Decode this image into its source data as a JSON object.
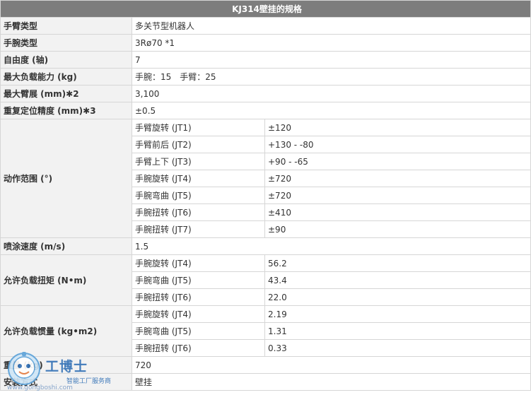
{
  "title": "KJ314壁挂的规格",
  "rows": {
    "arm_type": {
      "label": "手臂类型",
      "value": "多关节型机器人"
    },
    "wrist_type": {
      "label": "手腕类型",
      "value": "3Rø70 *1"
    },
    "dof": {
      "label": "自由度 (轴)",
      "value": "7"
    },
    "payload": {
      "label": "最大负载能力 (kg)",
      "value": "手腕：15　手臂：25"
    },
    "reach": {
      "label": "最大臂展 (mm)✱2",
      "value": "3,100"
    },
    "repeatability": {
      "label": "重复定位精度 (mm)✱3",
      "value": "±0.5"
    },
    "motion_range": {
      "label": "动作范围 (°)",
      "items": [
        {
          "axis": "手臂旋转 (JT1)",
          "value": "±120"
        },
        {
          "axis": "手臂前后 (JT2)",
          "value": "+130 - -80"
        },
        {
          "axis": "手臂上下 (JT3)",
          "value": "+90 - -65"
        },
        {
          "axis": "手腕旋转 (JT4)",
          "value": "±720"
        },
        {
          "axis": "手腕弯曲 (JT5)",
          "value": "±720"
        },
        {
          "axis": "手腕扭转 (JT6)",
          "value": "±410"
        },
        {
          "axis": "手腕扭转 (JT7)",
          "value": "±90"
        }
      ]
    },
    "spray_speed": {
      "label": "喷涂速度 (m/s)",
      "value": "1.5"
    },
    "torque": {
      "label": "允许负载扭矩 (N•m)",
      "items": [
        {
          "axis": "手腕旋转 (JT4)",
          "value": "56.2"
        },
        {
          "axis": "手腕弯曲 (JT5)",
          "value": "43.4"
        },
        {
          "axis": "手腕扭转 (JT6)",
          "value": "22.0"
        }
      ]
    },
    "inertia": {
      "label": "允许负载惯量 (kg•m2)",
      "items": [
        {
          "axis": "手腕旋转 (JT4)",
          "value": "2.19"
        },
        {
          "axis": "手腕弯曲 (JT5)",
          "value": "1.31"
        },
        {
          "axis": "手腕扭转 (JT6)",
          "value": "0.33"
        }
      ]
    },
    "weight": {
      "label": "重量 (kg)",
      "value": "720"
    },
    "mounting": {
      "label": "安装方式",
      "value": "壁挂"
    }
  },
  "watermark": {
    "brand": "工博士",
    "tagline": "智能工厂服务商",
    "url": "www.gongboshi.com"
  },
  "colors": {
    "header_bg": "#7d7d7d",
    "label_bg": "#f2f2f2",
    "border": "#d6d6d6",
    "watermark": "#2f6fb5"
  }
}
